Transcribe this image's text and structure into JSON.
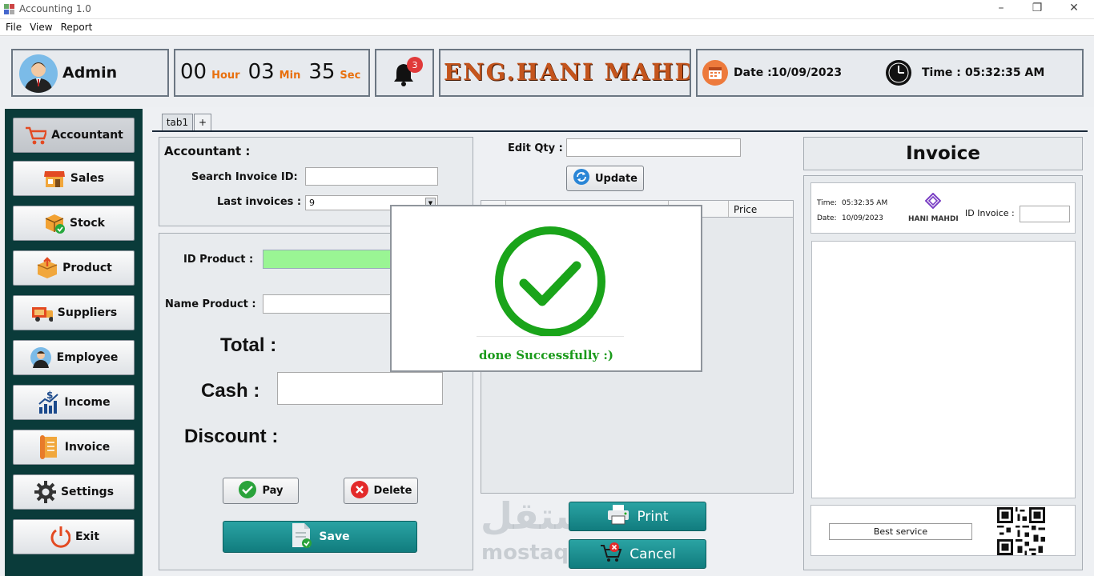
{
  "window": {
    "title": "Accounting 1.0"
  },
  "menu": [
    "File",
    "View",
    "Report"
  ],
  "header": {
    "user": "Admin",
    "timer": {
      "hours": "00",
      "hour_label": "Hour",
      "minutes": "03",
      "min_label": "Min",
      "seconds": "35",
      "sec_label": "Sec"
    },
    "notification_count": "3",
    "brand": "ENG.HANI MAHDI",
    "date_label": "Date :",
    "date_value": "10/09/2023",
    "time_label": "Time :",
    "time_value": "05:32:35 AM"
  },
  "nav": [
    {
      "label": "Accountant",
      "icon": "cart-icon",
      "active": true
    },
    {
      "label": "Sales",
      "icon": "store-icon"
    },
    {
      "label": "Stock",
      "icon": "box-check-icon"
    },
    {
      "label": "Product",
      "icon": "package-icon"
    },
    {
      "label": "Suppliers",
      "icon": "truck-icon"
    },
    {
      "label": "Employee",
      "icon": "person-icon"
    },
    {
      "label": "Income",
      "icon": "chart-dollar-icon"
    },
    {
      "label": "Invoice",
      "icon": "receipt-icon"
    },
    {
      "label": "Settings",
      "icon": "gear-icon"
    },
    {
      "label": "Exit",
      "icon": "power-icon"
    }
  ],
  "tabs": [
    {
      "label": "tab1"
    },
    {
      "label": "+"
    }
  ],
  "accountant": {
    "title": "Accountant :",
    "search_label": "Search Invoice ID:",
    "search_value": "",
    "last_label": "Last invoices :",
    "last_value": "9",
    "id_product_label": "ID Product :",
    "name_product_label": "Name Product :",
    "total_label": "Total :",
    "cash_label": "Cash :",
    "discount_label": "Discount :",
    "pay_label": "Pay",
    "delete_label": "Delete",
    "save_label": "Save"
  },
  "middle": {
    "edit_qty_label": "Edit Qty :",
    "update_label": "Update",
    "table_headers": [
      "",
      "",
      "",
      "Price"
    ],
    "print_label": "Print",
    "cancel_label": "Cancel"
  },
  "invoice": {
    "title": "Invoice",
    "time_label": "Time:",
    "time_value": "05:32:35 AM",
    "date_label": "Date:",
    "date_value": "10/09/2023",
    "logo_text": "HANI MAHDI",
    "id_label": "ID Invoice :",
    "footer_text": "Best service"
  },
  "dialog": {
    "message": "done Successfully :)"
  },
  "watermark": {
    "arabic": "مستقل",
    "latin": "mostaql.com"
  },
  "colors": {
    "sidebar": "#0a3b3a",
    "accent_orange": "#e8700e",
    "success_green": "#1a9a1a",
    "teal": "#117c7e"
  }
}
